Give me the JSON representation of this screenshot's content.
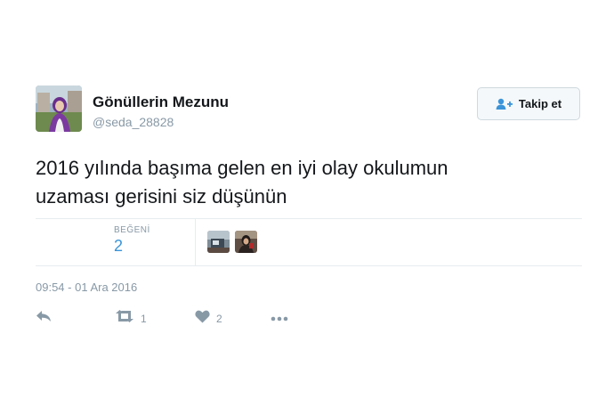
{
  "user": {
    "display_name": "Gönüllerin Mezunu",
    "handle": "@seda_28828"
  },
  "follow_button": {
    "label": "Takip et",
    "icon": "add-user-icon"
  },
  "tweet": {
    "text_line1": "2016 yılında başıma gelen en iyi olay okulumun",
    "text_line2": "uzaması gerisini siz düşünün"
  },
  "stats": {
    "likes_label": "BEĞENİ",
    "likes_count": "2"
  },
  "timestamp": "09:54 - 01 Ara 2016",
  "actions": {
    "retweet_count": "1",
    "like_count": "2"
  },
  "colors": {
    "accent": "#3b94d9",
    "muted": "#8899a6",
    "border": "#e6ecf0",
    "text": "#14171a"
  }
}
